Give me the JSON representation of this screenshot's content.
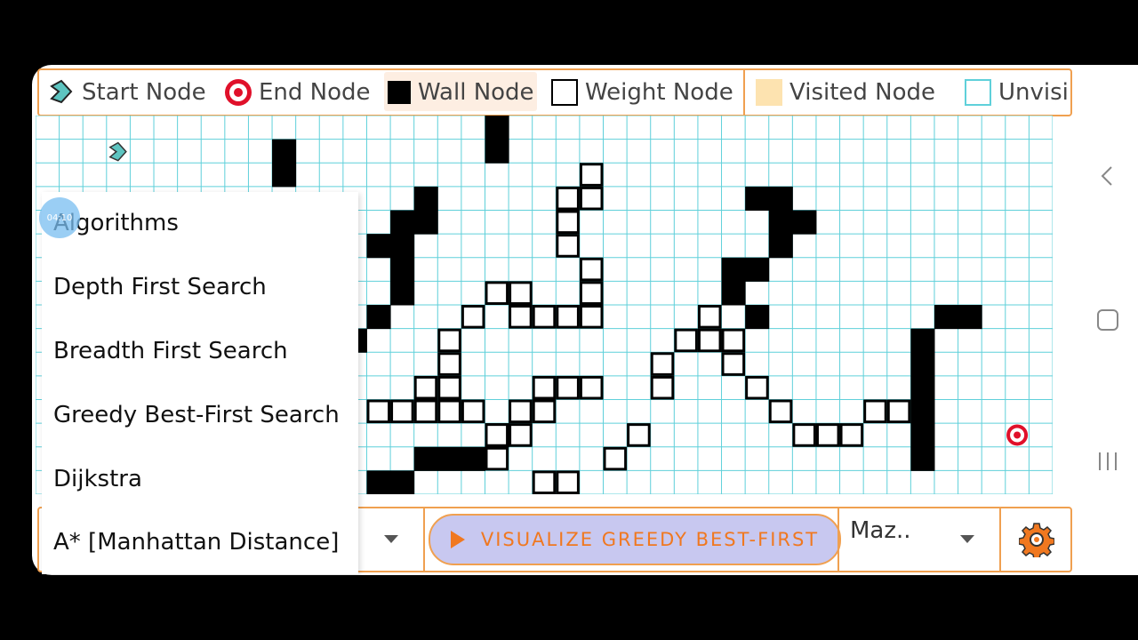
{
  "legend": {
    "items": [
      {
        "label": "Start Node",
        "icon": "start-node-icon"
      },
      {
        "label": "End Node",
        "icon": "end-node-icon"
      },
      {
        "label": "Wall Node",
        "icon": "wall-node-icon"
      },
      {
        "label": "Weight Node",
        "icon": "weight-node-icon"
      },
      {
        "label": "Visited Node",
        "icon": "visited-node-icon"
      },
      {
        "label": "Unvisi",
        "icon": "unvisited-node-icon"
      }
    ]
  },
  "dropdown": {
    "header": "Algorithms",
    "items": [
      "Depth First Search",
      "Breadth First Search",
      "Greedy Best-First Search",
      "Dijkstra",
      "A* [Manhattan Distance]"
    ]
  },
  "touch_indicator": "04:10",
  "toolbar": {
    "visualize_label": "VISUALIZE GREEDY BEST-FIRST",
    "maze_value": "Maz..",
    "settings_icon": "gear-icon"
  },
  "colors": {
    "accent_border": "#f0a050",
    "grid_line": "#5fd0da",
    "wall": "#000000",
    "visited": "#fde3b0",
    "end_node": "#e0102a",
    "start_node": "#5dc4c0",
    "button_bg": "#c8c8f0",
    "button_text": "#f07820"
  },
  "grid": {
    "cols": 43,
    "rows": 16,
    "start": [
      3,
      1
    ],
    "end": [
      41,
      13
    ],
    "walls": [
      [
        10,
        1
      ],
      [
        10,
        2
      ],
      [
        19,
        0
      ],
      [
        19,
        1
      ],
      [
        16,
        3
      ],
      [
        15,
        4
      ],
      [
        16,
        4
      ],
      [
        14,
        5
      ],
      [
        15,
        5
      ],
      [
        15,
        6
      ],
      [
        15,
        7
      ],
      [
        14,
        8
      ],
      [
        13,
        9
      ],
      [
        17,
        14
      ],
      [
        16,
        14
      ],
      [
        18,
        14
      ],
      [
        15,
        15
      ],
      [
        14,
        15
      ],
      [
        19,
        13
      ],
      [
        30,
        3
      ],
      [
        31,
        3
      ],
      [
        31,
        4
      ],
      [
        32,
        4
      ],
      [
        31,
        5
      ],
      [
        29,
        6
      ],
      [
        30,
        6
      ],
      [
        29,
        7
      ],
      [
        30,
        8
      ],
      [
        38,
        8
      ],
      [
        39,
        8
      ],
      [
        37,
        9
      ],
      [
        37,
        10
      ],
      [
        37,
        11
      ],
      [
        37,
        12
      ],
      [
        37,
        13
      ],
      [
        37,
        14
      ]
    ],
    "weights": [
      [
        23,
        2
      ],
      [
        22,
        3
      ],
      [
        23,
        3
      ],
      [
        22,
        4
      ],
      [
        22,
        5
      ],
      [
        23,
        6
      ],
      [
        19,
        7
      ],
      [
        20,
        7
      ],
      [
        23,
        7
      ],
      [
        18,
        8
      ],
      [
        20,
        8
      ],
      [
        21,
        8
      ],
      [
        22,
        8
      ],
      [
        23,
        8
      ],
      [
        17,
        9
      ],
      [
        17,
        10
      ],
      [
        16,
        11
      ],
      [
        17,
        11
      ],
      [
        21,
        11
      ],
      [
        22,
        11
      ],
      [
        23,
        11
      ],
      [
        14,
        12
      ],
      [
        15,
        12
      ],
      [
        16,
        12
      ],
      [
        17,
        12
      ],
      [
        18,
        12
      ],
      [
        20,
        12
      ],
      [
        21,
        12
      ],
      [
        19,
        13
      ],
      [
        20,
        13
      ],
      [
        25,
        13
      ],
      [
        19,
        14
      ],
      [
        24,
        14
      ],
      [
        21,
        15
      ],
      [
        22,
        15
      ],
      [
        28,
        8
      ],
      [
        27,
        9
      ],
      [
        28,
        9
      ],
      [
        29,
        9
      ],
      [
        26,
        10
      ],
      [
        29,
        10
      ],
      [
        26,
        11
      ],
      [
        30,
        11
      ],
      [
        31,
        12
      ],
      [
        32,
        13
      ],
      [
        33,
        13
      ],
      [
        34,
        13
      ],
      [
        35,
        12
      ],
      [
        36,
        12
      ]
    ]
  }
}
